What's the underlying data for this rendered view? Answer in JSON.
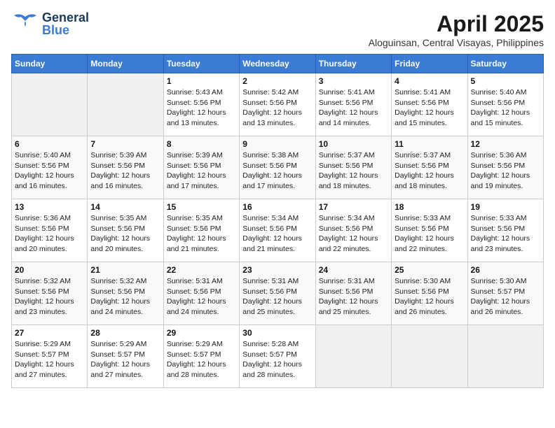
{
  "header": {
    "logo_general": "General",
    "logo_blue": "Blue",
    "month_year": "April 2025",
    "location": "Aloguinsan, Central Visayas, Philippines"
  },
  "days_of_week": [
    "Sunday",
    "Monday",
    "Tuesday",
    "Wednesday",
    "Thursday",
    "Friday",
    "Saturday"
  ],
  "weeks": [
    [
      {
        "day": "",
        "info": ""
      },
      {
        "day": "",
        "info": ""
      },
      {
        "day": "1",
        "info": "Sunrise: 5:43 AM\nSunset: 5:56 PM\nDaylight: 12 hours\nand 13 minutes."
      },
      {
        "day": "2",
        "info": "Sunrise: 5:42 AM\nSunset: 5:56 PM\nDaylight: 12 hours\nand 13 minutes."
      },
      {
        "day": "3",
        "info": "Sunrise: 5:41 AM\nSunset: 5:56 PM\nDaylight: 12 hours\nand 14 minutes."
      },
      {
        "day": "4",
        "info": "Sunrise: 5:41 AM\nSunset: 5:56 PM\nDaylight: 12 hours\nand 15 minutes."
      },
      {
        "day": "5",
        "info": "Sunrise: 5:40 AM\nSunset: 5:56 PM\nDaylight: 12 hours\nand 15 minutes."
      }
    ],
    [
      {
        "day": "6",
        "info": "Sunrise: 5:40 AM\nSunset: 5:56 PM\nDaylight: 12 hours\nand 16 minutes."
      },
      {
        "day": "7",
        "info": "Sunrise: 5:39 AM\nSunset: 5:56 PM\nDaylight: 12 hours\nand 16 minutes."
      },
      {
        "day": "8",
        "info": "Sunrise: 5:39 AM\nSunset: 5:56 PM\nDaylight: 12 hours\nand 17 minutes."
      },
      {
        "day": "9",
        "info": "Sunrise: 5:38 AM\nSunset: 5:56 PM\nDaylight: 12 hours\nand 17 minutes."
      },
      {
        "day": "10",
        "info": "Sunrise: 5:37 AM\nSunset: 5:56 PM\nDaylight: 12 hours\nand 18 minutes."
      },
      {
        "day": "11",
        "info": "Sunrise: 5:37 AM\nSunset: 5:56 PM\nDaylight: 12 hours\nand 18 minutes."
      },
      {
        "day": "12",
        "info": "Sunrise: 5:36 AM\nSunset: 5:56 PM\nDaylight: 12 hours\nand 19 minutes."
      }
    ],
    [
      {
        "day": "13",
        "info": "Sunrise: 5:36 AM\nSunset: 5:56 PM\nDaylight: 12 hours\nand 20 minutes."
      },
      {
        "day": "14",
        "info": "Sunrise: 5:35 AM\nSunset: 5:56 PM\nDaylight: 12 hours\nand 20 minutes."
      },
      {
        "day": "15",
        "info": "Sunrise: 5:35 AM\nSunset: 5:56 PM\nDaylight: 12 hours\nand 21 minutes."
      },
      {
        "day": "16",
        "info": "Sunrise: 5:34 AM\nSunset: 5:56 PM\nDaylight: 12 hours\nand 21 minutes."
      },
      {
        "day": "17",
        "info": "Sunrise: 5:34 AM\nSunset: 5:56 PM\nDaylight: 12 hours\nand 22 minutes."
      },
      {
        "day": "18",
        "info": "Sunrise: 5:33 AM\nSunset: 5:56 PM\nDaylight: 12 hours\nand 22 minutes."
      },
      {
        "day": "19",
        "info": "Sunrise: 5:33 AM\nSunset: 5:56 PM\nDaylight: 12 hours\nand 23 minutes."
      }
    ],
    [
      {
        "day": "20",
        "info": "Sunrise: 5:32 AM\nSunset: 5:56 PM\nDaylight: 12 hours\nand 23 minutes."
      },
      {
        "day": "21",
        "info": "Sunrise: 5:32 AM\nSunset: 5:56 PM\nDaylight: 12 hours\nand 24 minutes."
      },
      {
        "day": "22",
        "info": "Sunrise: 5:31 AM\nSunset: 5:56 PM\nDaylight: 12 hours\nand 24 minutes."
      },
      {
        "day": "23",
        "info": "Sunrise: 5:31 AM\nSunset: 5:56 PM\nDaylight: 12 hours\nand 25 minutes."
      },
      {
        "day": "24",
        "info": "Sunrise: 5:31 AM\nSunset: 5:56 PM\nDaylight: 12 hours\nand 25 minutes."
      },
      {
        "day": "25",
        "info": "Sunrise: 5:30 AM\nSunset: 5:56 PM\nDaylight: 12 hours\nand 26 minutes."
      },
      {
        "day": "26",
        "info": "Sunrise: 5:30 AM\nSunset: 5:57 PM\nDaylight: 12 hours\nand 26 minutes."
      }
    ],
    [
      {
        "day": "27",
        "info": "Sunrise: 5:29 AM\nSunset: 5:57 PM\nDaylight: 12 hours\nand 27 minutes."
      },
      {
        "day": "28",
        "info": "Sunrise: 5:29 AM\nSunset: 5:57 PM\nDaylight: 12 hours\nand 27 minutes."
      },
      {
        "day": "29",
        "info": "Sunrise: 5:29 AM\nSunset: 5:57 PM\nDaylight: 12 hours\nand 28 minutes."
      },
      {
        "day": "30",
        "info": "Sunrise: 5:28 AM\nSunset: 5:57 PM\nDaylight: 12 hours\nand 28 minutes."
      },
      {
        "day": "",
        "info": ""
      },
      {
        "day": "",
        "info": ""
      },
      {
        "day": "",
        "info": ""
      }
    ]
  ]
}
